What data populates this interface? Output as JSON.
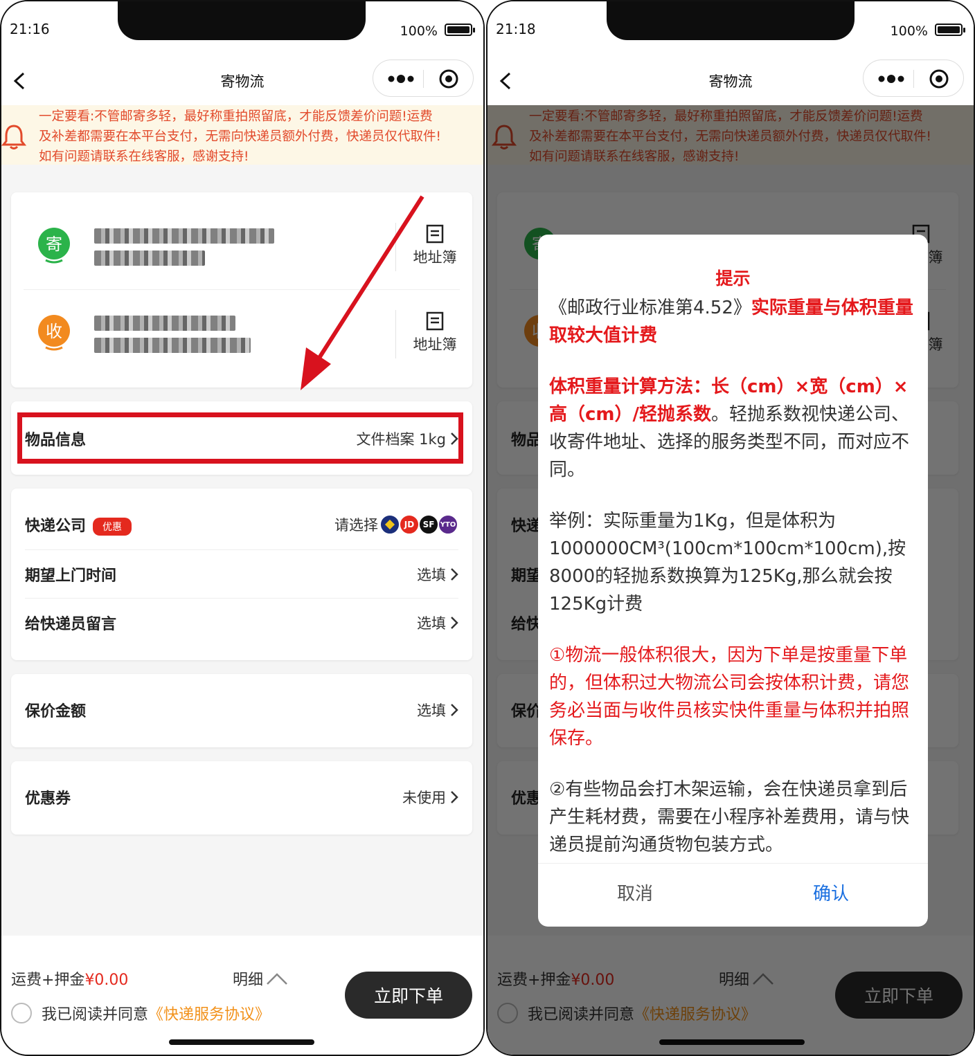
{
  "left": {
    "status": {
      "time": "21:16",
      "battery": "100%"
    },
    "nav": {
      "title": "寄物流"
    },
    "notice": "一定要看:不管邮寄多轻，最好称重拍照留底，才能反馈差价问题!运费\n及补差都需要在本平台支付，无需向快递员额外付费，快递员仅代取件!\n如有问题请联系在线客服，感谢支持!",
    "sender": {
      "badge": "寄",
      "book": "地址簿"
    },
    "receiver": {
      "badge": "收",
      "book": "地址簿"
    },
    "item_info": {
      "label": "物品信息",
      "value": "文件档案 1kg"
    },
    "courier": {
      "label": "快递公司",
      "tag": "优惠",
      "value": "请选择",
      "logos": [
        "JD",
        "SF",
        "YTO"
      ]
    },
    "pickup_time": {
      "label": "期望上门时间",
      "value": "选填"
    },
    "message": {
      "label": "给快递员留言",
      "value": "选填"
    },
    "insured": {
      "label": "保价金额",
      "value": "选填"
    },
    "coupon": {
      "label": "优惠券",
      "value": "未使用"
    },
    "footer": {
      "fee_label": "运费+押金",
      "fee_value": "¥0.00",
      "detail": "明细",
      "agree_text": "我已阅读并同意",
      "agree_link": "《快递服务协议》",
      "order": "立即下单"
    }
  },
  "right": {
    "status": {
      "time": "21:18",
      "battery": "100%"
    },
    "nav": {
      "title": "寄物流"
    },
    "modal": {
      "title": "提示",
      "p1_normal": "《邮政行业标准第4.52》",
      "p1_red": "实际重量与体积重量取较大值计费",
      "p2_red": "体积重量计算方法：长（cm）×宽（cm）×高（cm）/轻抛系数",
      "p2_normal": "。轻抛系数视快递公司、收寄件地址、选择的服务类型不同，而对应不同。",
      "p3": "举例：实际重量为1Kg，但是体积为1000000CM³(100cm*100cm*100cm),按8000的轻抛系数换算为125Kg,那么就会按125Kg计费",
      "p4": "①物流一般体积很大，因为下单是按重量下单的，但体积过大物流公司会按体积计费，请您务必当面与收件员核实快件重量与体积并拍照保存。",
      "p5": "②有些物品会打木架运输，会在快递员拿到后产生耗材费，需要在小程序补差费用，请与快递员提前沟通货物包装方式。",
      "cancel": "取消",
      "confirm": "确认"
    }
  },
  "colors": {
    "accent_red": "#e4291e",
    "link_orange": "#f2911a",
    "confirm_blue": "#1a6fe0",
    "button_dark": "#2a2a2a"
  }
}
